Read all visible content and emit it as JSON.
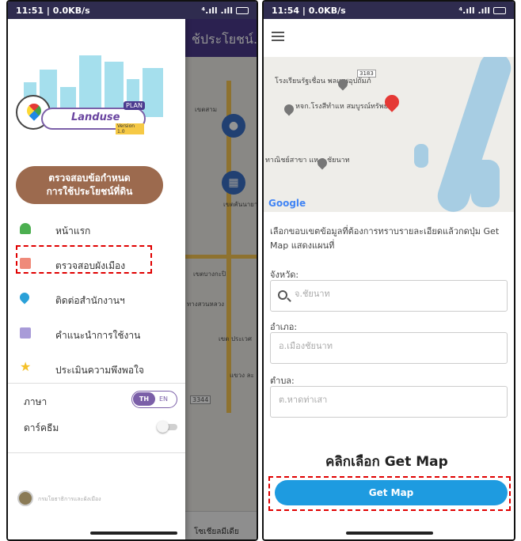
{
  "left_screen": {
    "status_bar": {
      "time_speed": "11:51 | 0.0KB/s",
      "signal_text": "⁴.ıll .ıll"
    },
    "background": {
      "title": "ช้ประโยชน์...",
      "map_labels": [
        "เขตสาม",
        "เขตคันนายาว",
        "เขตบางกะปิ",
        "เขต ประเวศ",
        "แขวง ละ",
        "ทางสวนหลวง",
        "3344"
      ],
      "bottom_nav_label": "โซเชียลมีเดีย"
    },
    "drawer": {
      "brand": {
        "name": "Landuse",
        "tag": "PLAN",
        "version": "Version 1.0"
      },
      "primary_button": {
        "line1": "ตรวจสอบข้อกำหนด",
        "line2": "การใช้ประโยชน์ที่ดิน"
      },
      "menu_items": [
        {
          "label": "หน้าแรก",
          "icon": "home-icon"
        },
        {
          "label": "ตรวจสอบผังเมือง",
          "icon": "map-search-icon"
        },
        {
          "label": "ติดต่อสำนักงานฯ",
          "icon": "location-icon"
        },
        {
          "label": "คำแนะนำการใช้งาน",
          "icon": "book-icon"
        },
        {
          "label": "ประเมินความพึงพอใจ",
          "icon": "star-icon"
        }
      ],
      "language": {
        "label": "ภาษา",
        "th": "TH",
        "en": "EN",
        "selected": "TH"
      },
      "dark_theme": {
        "label": "ดาร์คธีม",
        "enabled": false
      },
      "footer_text": "กรมโยธาธิการและผังเมือง"
    }
  },
  "right_screen": {
    "status_bar": {
      "time_speed": "11:54 | 0.0KB/s",
      "signal_text": "⁴.ıll .ıll"
    },
    "map": {
      "labels": [
        "โรงเรียนรัฐเชื่อน พลเทพอุปถัมภ์",
        "หจก.โรงสีทำแห สมบูรณ์ทรัพย์",
        "ทาณิชย์สาขา แห จ.ชัยนาท"
      ],
      "route_badge": "3183",
      "attribution": "Google"
    },
    "form": {
      "intro": "เลือกขอบเขตข้อมูลที่ต้องการทราบรายละเอียดแล้วกดปุ่ม Get Map แสดงแผนที่",
      "province": {
        "label": "จังหวัด:",
        "placeholder": "จ.ชัยนาท"
      },
      "district": {
        "label": "อำเภอ:",
        "placeholder": "อ.เมืองชัยนาท"
      },
      "subdistrict": {
        "label": "ตำบล:",
        "placeholder": "ต.หาดท่าเสา"
      },
      "callout": "คลิกเลือก Get Map",
      "get_map_button": "Get Map"
    }
  },
  "colors": {
    "drawer_primary": "#9c6a4e",
    "accent_purple": "#7b5fa8",
    "get_map_blue": "#1e9be0",
    "highlight_red": "#e00000"
  }
}
